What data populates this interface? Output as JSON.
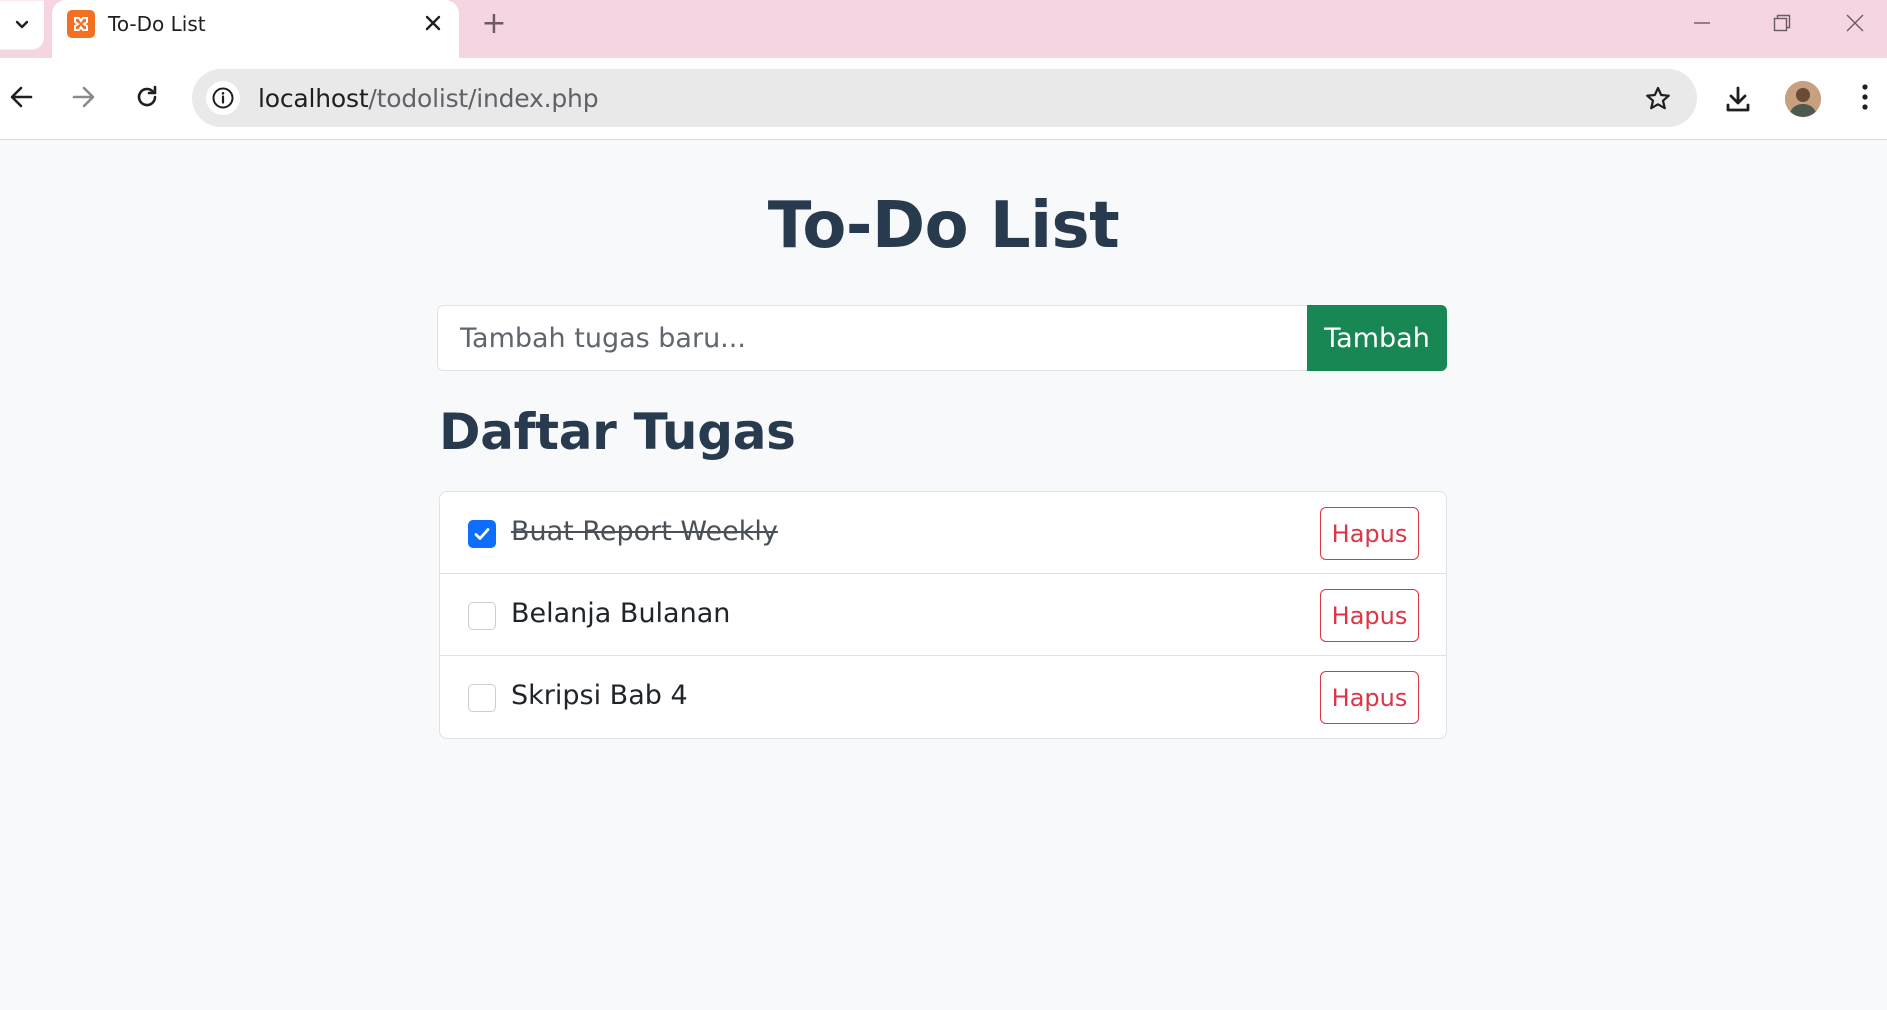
{
  "browser": {
    "tab_title": "To-Do List",
    "new_tab_symbol": "+",
    "url_host": "localhost",
    "url_path": "/todolist/index.php",
    "icons": {
      "tab_search": "chevron-down-icon",
      "favicon": "xampp-icon",
      "close": "close-icon",
      "back": "arrow-left-icon",
      "forward": "arrow-right-icon",
      "reload": "reload-icon",
      "site_info": "info-icon",
      "bookmark": "star-icon",
      "download": "download-icon",
      "menu": "kebab-menu-icon"
    },
    "colors": {
      "tabbar": "#f6d5e3",
      "omnibox": "#e9e9ea"
    }
  },
  "page": {
    "title": "To-Do List",
    "input": {
      "placeholder": "Tambah tugas baru...",
      "value": ""
    },
    "add_button_label": "Tambah",
    "list_heading": "Daftar Tugas",
    "tasks": [
      {
        "text": "Buat Report Weekly",
        "done": true,
        "delete_label": "Hapus"
      },
      {
        "text": "Belanja Bulanan",
        "done": false,
        "delete_label": "Hapus"
      },
      {
        "text": "Skripsi Bab 4",
        "done": false,
        "delete_label": "Hapus"
      }
    ],
    "colors": {
      "heading": "#283a4d",
      "success": "#198754",
      "danger": "#dc3545",
      "primary": "#0d6efd"
    }
  }
}
